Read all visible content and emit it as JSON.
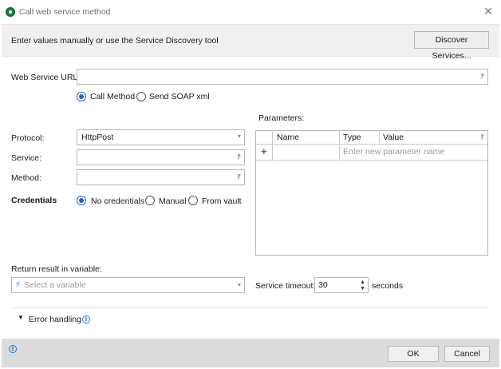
{
  "window": {
    "title": "Call web service method"
  },
  "header": {
    "instruction": "Enter values manually or use the Service Discovery tool",
    "discover_label": "Discover Services..."
  },
  "url": {
    "label": "Web Service URL:",
    "value": ""
  },
  "mode": {
    "options": [
      "Call Method",
      "Send SOAP xml"
    ],
    "selected": "Call Method"
  },
  "protocol": {
    "label": "Protocol:",
    "value": "HttpPost"
  },
  "service": {
    "label": "Service:",
    "value": ""
  },
  "method": {
    "label": "Method:",
    "value": ""
  },
  "credentials": {
    "label": "Credentials",
    "options": [
      "No credentials",
      "Manual",
      "From vault"
    ],
    "selected": "No credentials"
  },
  "parameters": {
    "label": "Parameters:",
    "columns": [
      "Name",
      "Type",
      "Value"
    ],
    "new_row_placeholder": "Enter new parameter name"
  },
  "result": {
    "label": "Return result in variable:",
    "placeholder": "Select a variable"
  },
  "timeout": {
    "label": "Service timeout:",
    "value": "30",
    "unit": "seconds"
  },
  "error_handling": {
    "label": "Error handling"
  },
  "footer": {
    "ok_label": "OK",
    "cancel_label": "Cancel"
  },
  "icons": {
    "app": "app-icon",
    "close": "close-icon",
    "pin": "pin-icon",
    "dropdown": "chevron-down-icon",
    "add": "plus-icon",
    "variable": "lightning-icon",
    "info": "info-icon"
  },
  "colors": {
    "accent": "#1c62c2",
    "app_icon": "#17803c",
    "add": "#2e8b2e"
  }
}
